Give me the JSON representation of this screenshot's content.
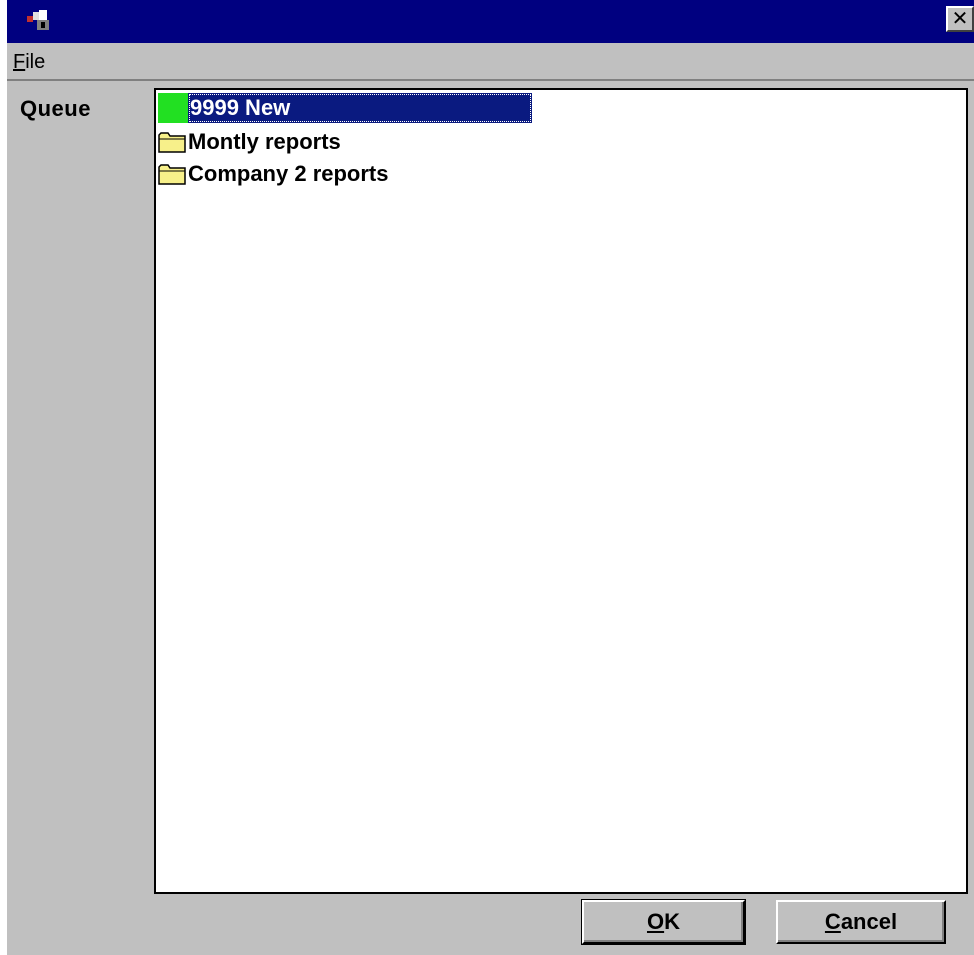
{
  "window": {
    "close_glyph": "✕"
  },
  "menu": {
    "file_accel": "F",
    "file_rest": "ile"
  },
  "queue": {
    "label": "Queue",
    "items": [
      {
        "label": "9999 New",
        "icon": "green-color-swatch",
        "selected": true,
        "color": "#22e022"
      },
      {
        "label": "Montly reports",
        "icon": "folder-icon",
        "selected": false
      },
      {
        "label": "Company 2 reports",
        "icon": "folder-icon",
        "selected": false
      }
    ]
  },
  "buttons": {
    "ok_accel": "O",
    "ok_rest": "K",
    "cancel_accel": "C",
    "cancel_rest": "ancel"
  },
  "colors": {
    "titlebar": "#000080",
    "face": "#c0c0c0",
    "selection": "#0a1a80",
    "folder": "#f7f08a"
  }
}
